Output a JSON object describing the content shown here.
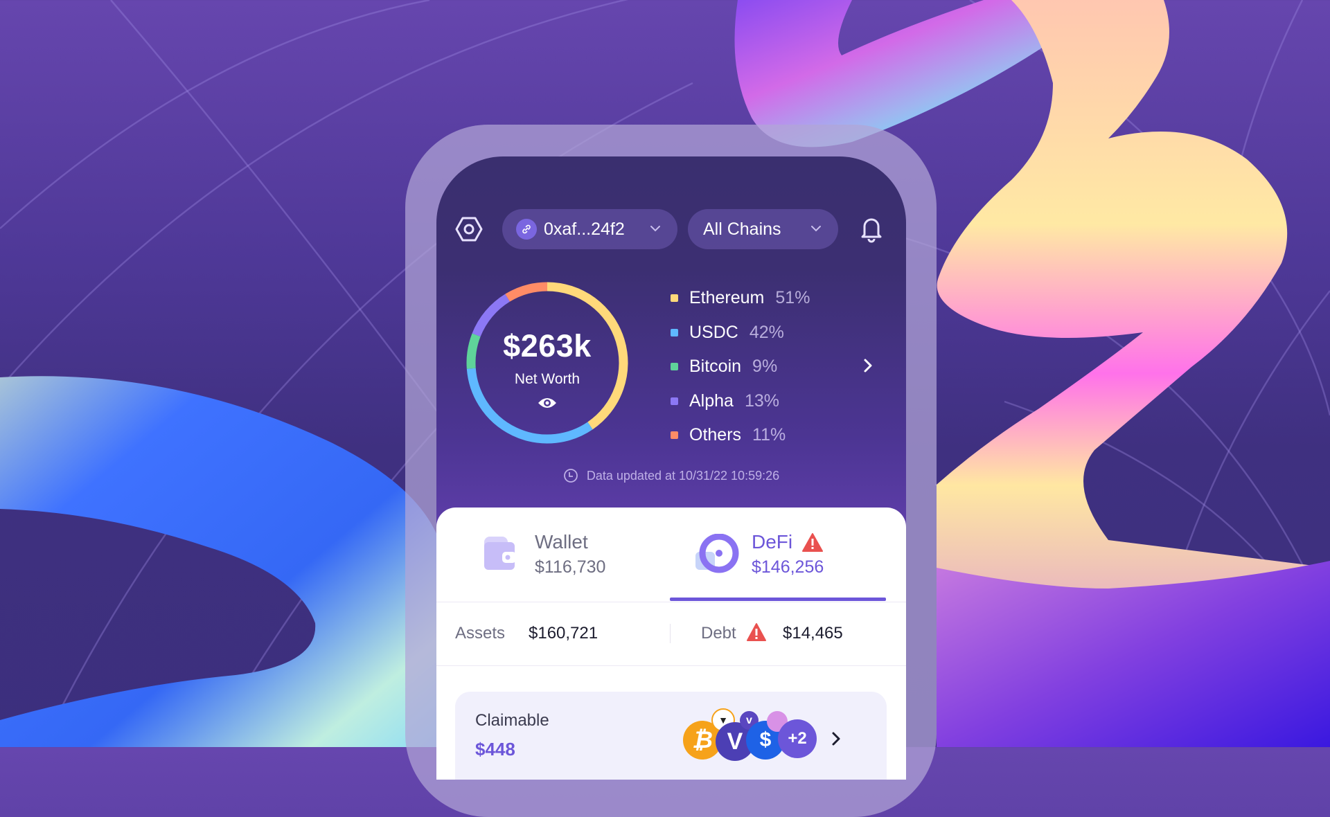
{
  "header": {
    "settings_icon": "hexagon-settings-icon",
    "address": "0xaf...24f2",
    "address_icon": "link-icon",
    "chain_selector": "All Chains",
    "notification_icon": "bell-icon"
  },
  "net_worth": {
    "value": "$263k",
    "label": "Net Worth",
    "visibility_icon": "eye-icon"
  },
  "chart_data": {
    "type": "pie",
    "title": "Net Worth",
    "center_label": "$263k",
    "categories": [
      "Ethereum",
      "USDC",
      "Bitcoin",
      "Alpha",
      "Others"
    ],
    "values": [
      51,
      42,
      9,
      13,
      11
    ],
    "labels": [
      "51%",
      "42%",
      "9%",
      "13%",
      "11%"
    ],
    "colors": [
      "#ffd97a",
      "#5fb8ff",
      "#5fd39a",
      "#8c78f5",
      "#ff8c66"
    ],
    "legend": "right"
  },
  "legend": [
    {
      "name": "Ethereum",
      "pct": "51%",
      "color": "#ffd97a"
    },
    {
      "name": "USDC",
      "pct": "42%",
      "color": "#5fb8ff"
    },
    {
      "name": "Bitcoin",
      "pct": "9%",
      "color": "#5fd39a"
    },
    {
      "name": "Alpha",
      "pct": "13%",
      "color": "#8c78f5"
    },
    {
      "name": "Others",
      "pct": "11%",
      "color": "#ff8c66"
    }
  ],
  "updated": "Data updated at 10/31/22 10:59:26",
  "tabs": [
    {
      "label": "Wallet",
      "value": "$116,730",
      "active": false
    },
    {
      "label": "DeFi",
      "value": "$146,256",
      "active": true,
      "warning": true
    }
  ],
  "summary": {
    "assets_label": "Assets",
    "assets_value": "$160,721",
    "debt_label": "Debt",
    "debt_value": "$14,465"
  },
  "claimable": {
    "label": "Claimable",
    "value": "$448",
    "extra_count": "+2",
    "tokens": [
      "bitcoin-token-icon",
      "badger-token-icon",
      "vesper-token-icon",
      "vesper-small-token-icon",
      "synthetix-token-icon",
      "pink-token-icon"
    ]
  },
  "colors": {
    "accent": "#6c56d9",
    "warning": "#e9514f",
    "background": "#4e3897"
  }
}
